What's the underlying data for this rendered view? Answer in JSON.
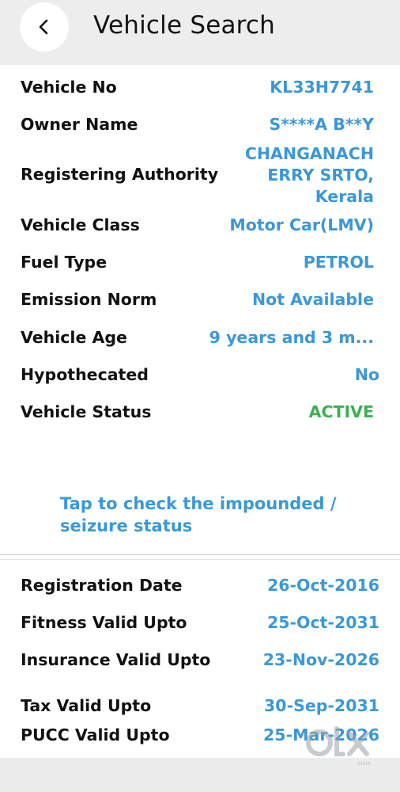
{
  "header": {
    "title": "Vehicle Search",
    "back_icon": "chevron-left-icon"
  },
  "details": {
    "vehicle_no": {
      "label": "Vehicle No",
      "value": "KL33H7741"
    },
    "owner_name": {
      "label": "Owner Name",
      "value": "S****A B**Y"
    },
    "registering_authority": {
      "label": "Registering Authority",
      "value_line1": "CHANGANACH",
      "value_line2": "ERRY SRTO,",
      "value_line3": "Kerala"
    },
    "vehicle_class": {
      "label": "Vehicle Class",
      "value": "Motor Car(LMV)"
    },
    "fuel_type": {
      "label": "Fuel Type",
      "value": "PETROL"
    },
    "emission_norm": {
      "label": "Emission Norm",
      "value": "Not Available"
    },
    "vehicle_age": {
      "label": "Vehicle Age",
      "value": "9 years and 3 m..."
    },
    "hypothecated": {
      "label": "Hypothecated",
      "value": "No"
    },
    "vehicle_status": {
      "label": "Vehicle Status",
      "value": "ACTIVE"
    }
  },
  "impound_link": "Tap to check the impounded / seizure status",
  "validity": {
    "registration_date": {
      "label": "Registration Date",
      "value": "26-Oct-2016"
    },
    "fitness": {
      "label": "Fitness Valid Upto",
      "value": "25-Oct-2031"
    },
    "insurance": {
      "label": "Insurance Valid Upto",
      "value": "23-Nov-2026"
    },
    "tax": {
      "label": "Tax Valid Upto",
      "value": "30-Sep-2031"
    },
    "pucc": {
      "label": "PUCC Valid Upto",
      "value": "25-Mar-2026"
    }
  },
  "watermark": {
    "brand": "OLX",
    "sub": "INDIA"
  },
  "colors": {
    "accent": "#3a98d8",
    "status_active": "#3ab14f",
    "header_bg": "#ededee"
  }
}
